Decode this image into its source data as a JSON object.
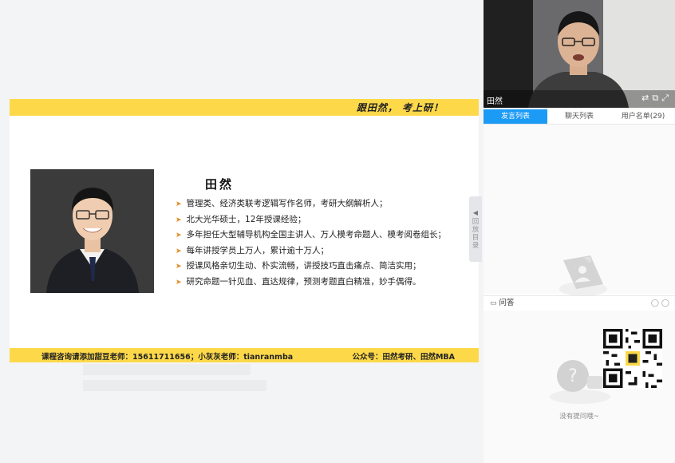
{
  "slide": {
    "slogan": "跟田然， 考上研！",
    "teacher_name": "田然",
    "bullets": [
      "管理类、经济类联考逻辑写作名师，考研大纲解析人；",
      "北大光华硕士，12年授课经验；",
      "多年担任大型辅导机构全国主讲人、万人模考命题人、模考阅卷组长；",
      "每年讲授学员上万人，累计逾十万人；",
      "授课风格亲切生动、朴实流畅，讲授技巧直击痛点、简洁实用；",
      "研究命题一针见血、直达规律，预测考题直白精准，妙手偶得。"
    ],
    "contact": "课程咨询请添加甜豆老师：15611711656；小灰灰老师：tianranmba",
    "wechat": "公众号：田然考研、田然MBA",
    "accent_color": "#fdd94a",
    "bullet_arrow_color": "#e08a1a"
  },
  "collapse_tab": {
    "label": "回放目录"
  },
  "video": {
    "presenter": "田然"
  },
  "tabs": [
    {
      "label": "发言列表",
      "active": true
    },
    {
      "label": "聊天列表",
      "active": false
    },
    {
      "label": "用户名单(29)",
      "active": false
    }
  ],
  "qa": {
    "title": "问答",
    "empty_text": "没有提问哦~"
  },
  "colors": {
    "tab_active": "#1b9af6"
  }
}
